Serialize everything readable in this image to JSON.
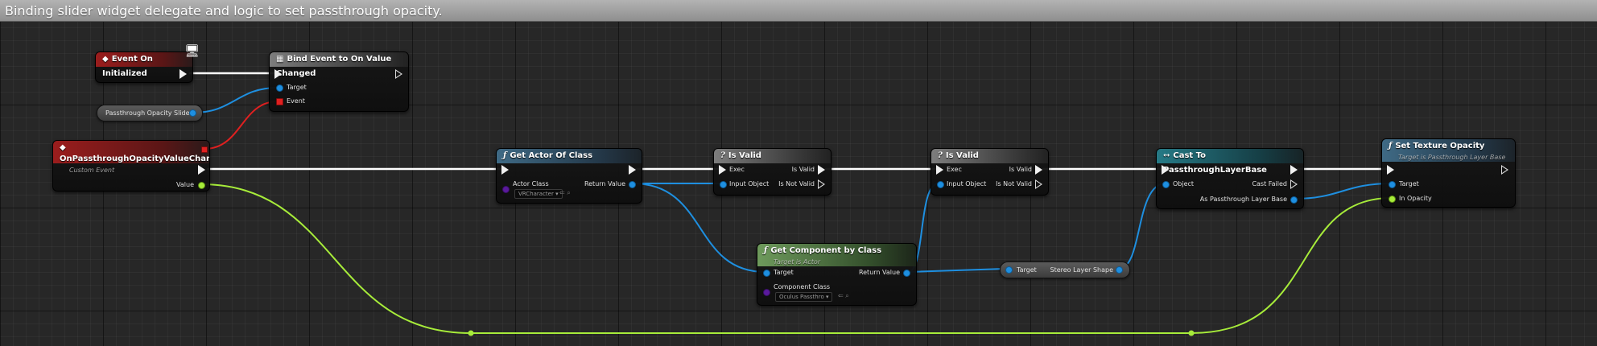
{
  "title": "Binding slider widget delegate and logic to set passthrough opacity.",
  "nodes": {
    "event_on_initialized": {
      "title": "Event On Initialized"
    },
    "bind_event": {
      "title": "Bind Event to On Value Changed",
      "target": "Target",
      "event": "Event"
    },
    "slider_var": {
      "label": "Passthrough Opacity Slider"
    },
    "custom_event": {
      "title": "OnPassthroughOpacityValueChanged",
      "subtitle": "Custom Event",
      "value": "Value"
    },
    "get_actor": {
      "title": "Get Actor Of Class",
      "actor_class": "Actor Class",
      "return_value": "Return Value",
      "class_value": "VRCharacter"
    },
    "is_valid_1": {
      "title": "Is Valid",
      "exec": "Exec",
      "is_valid": "Is Valid",
      "input_object": "Input Object",
      "is_not_valid": "Is Not Valid"
    },
    "is_valid_2": {
      "title": "Is Valid",
      "exec": "Exec",
      "is_valid": "Is Valid",
      "input_object": "Input Object",
      "is_not_valid": "Is Not Valid"
    },
    "get_component": {
      "title": "Get Component by Class",
      "subtitle": "Target is Actor",
      "target": "Target",
      "return_value": "Return Value",
      "component_class": "Component Class",
      "class_value": "Oculus Passthro"
    },
    "stereo_layer": {
      "target": "Target",
      "output": "Stereo Layer Shape"
    },
    "cast": {
      "title": "Cast To PassthroughLayerBase",
      "object": "Object",
      "cast_failed": "Cast Failed",
      "as_output": "As Passthrough Layer Base"
    },
    "set_opacity": {
      "title": "Set Texture Opacity",
      "subtitle": "Target is Passthrough Layer Base",
      "target": "Target",
      "in_opacity": "In Opacity"
    }
  },
  "colors": {
    "exec_wire": "#ffffff",
    "object_wire": "#1e8fe0",
    "float_wire": "#a7ec3a",
    "event_wire": "#e02020"
  },
  "icons": {
    "event": "diamond-icon",
    "function": "function-f-icon",
    "macro": "question-icon",
    "cast": "cast-arrows-icon",
    "bind": "grid-icon"
  }
}
